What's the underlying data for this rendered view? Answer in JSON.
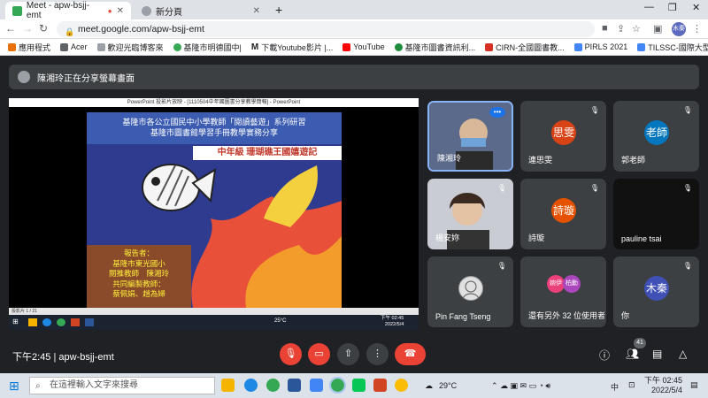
{
  "browser": {
    "tabs": [
      {
        "title": "Meet - apw-bsjj-emt",
        "active": true
      },
      {
        "title": "新分頁",
        "active": false
      }
    ],
    "url": "meet.google.com/apw-bsjj-emt",
    "profile": "木秦",
    "bookmarks": [
      "應用程式",
      "Acer",
      "歡迎光臨博客來",
      "基隆市明德國中|",
      "下載Youtube影片 |...",
      "YouTube",
      "基隆市圖書資訊利...",
      "CIRN-全國圖書教...",
      "PIRLS 2021",
      "TILSSC-國際大型教..."
    ]
  },
  "meet": {
    "presenting_banner": "陳湘玲正在分享螢幕畫面",
    "slide": {
      "window_title": "PowerPoint 投影片放映 - [1110504中年國圖書分享教學簡報] - PowerPoint",
      "header_line1": "基隆市各公立國民中小學教師「閱讀藝遊」系列研習",
      "header_line2": "基隆市圖書館學習手冊教學實務分享",
      "subtitle": "中年級 珊瑚礁王國嬉遊記",
      "reporter_lines": [
        "報告者：",
        "基隆市東光國小",
        "閱推教師　陳湘玲",
        "共同編製教師：",
        "蔡佩娟、趙為婦"
      ],
      "status": "投影片 1 / 21",
      "mini_time": "下午 02:45",
      "mini_date": "2022/5/4",
      "mini_temp": "25°C"
    },
    "participants": [
      {
        "name": "陳湘玲",
        "initials": "",
        "color": "#5b6a8a"
      },
      {
        "name": "連思雯",
        "initials": "思雯",
        "color": "#d84315"
      },
      {
        "name": "郭老師",
        "initials": "老師",
        "color": "#0277bd"
      },
      {
        "name": "楊安妳",
        "initials": "",
        "color": "#6d7a88"
      },
      {
        "name": "詩璇",
        "initials": "詩璇",
        "color": "#e65100"
      },
      {
        "name": "pauline tsai",
        "initials": "",
        "color": "#111111"
      },
      {
        "name": "Pin Fang Tseng",
        "initials": "",
        "color": "#e0e0e0"
      },
      {
        "name": "還有另外 32 位使用者",
        "initials": "",
        "color": "#3c4043"
      },
      {
        "name": "你",
        "initials": "木秦",
        "color": "#3f51b5"
      }
    ],
    "others_avatars": [
      "婉伊",
      "柏勳"
    ],
    "controls": {
      "time": "下午2:45",
      "meeting_code": "apw-bsjj-emt",
      "people_count": "41"
    }
  },
  "taskbar": {
    "search_placeholder": "在這裡輸入文字來搜尋",
    "weather": "29°C",
    "ime": "中",
    "time": "下午 02:45",
    "date": "2022/5/4"
  }
}
